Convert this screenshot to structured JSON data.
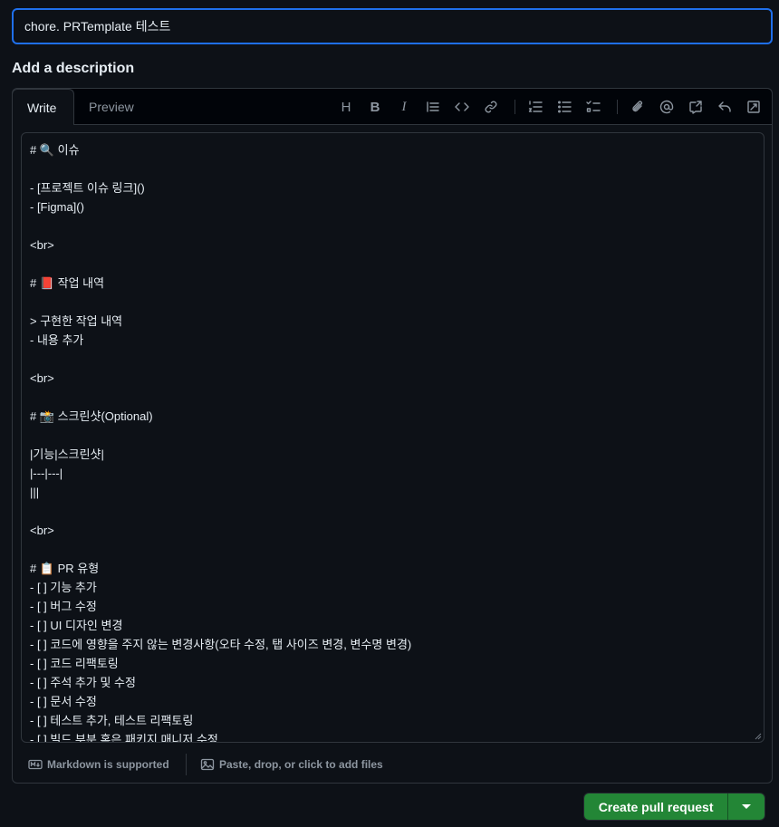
{
  "pr": {
    "title_value": "chore. PRTemplate 테스트",
    "description_heading": "Add a description"
  },
  "editor": {
    "tabs": [
      {
        "label": "Write",
        "active": true
      },
      {
        "label": "Preview",
        "active": false
      }
    ],
    "toolbar": {
      "heading": "H",
      "bold": "B",
      "italic": "I"
    },
    "lines": [
      "# 🔍 이슈",
      "",
      "- [프로젝트 이슈 링크]()",
      "- [Figma]()",
      "",
      "<br>",
      "",
      "# 📕 작업 내역",
      "",
      "> 구현한 작업 내역",
      "- 내용 추가",
      "",
      "<br>",
      "",
      "# 📸 스크린샷(Optional)",
      "",
      "|기능|스크린샷|",
      "|---|---|",
      "|||",
      "",
      "<br>",
      "",
      "# 📋 PR 유형",
      "- [ ] 기능 추가",
      "- [ ] 버그 수정",
      "- [ ] UI 디자인 변경",
      "- [ ] 코드에 영향을 주지 않는 변경사항(오타 수정, 탭 사이즈 변경, 변수명 변경)",
      "- [ ] 코드 리팩토링",
      "- [ ] 주석 추가 및 수정",
      "- [ ] 문서 수정",
      "- [ ] 테스트 추가, 테스트 리팩토링",
      "- [ ] 빌드 부분 혹은 패키지 매니저 수정"
    ],
    "footer": {
      "markdown_label": "Markdown is supported",
      "attach_label": "Paste, drop, or click to add files"
    }
  },
  "actions": {
    "create_label": "Create pull request"
  },
  "colors": {
    "accent_border": "#1f6feb",
    "primary_button": "#238636",
    "background": "#0d1117"
  }
}
